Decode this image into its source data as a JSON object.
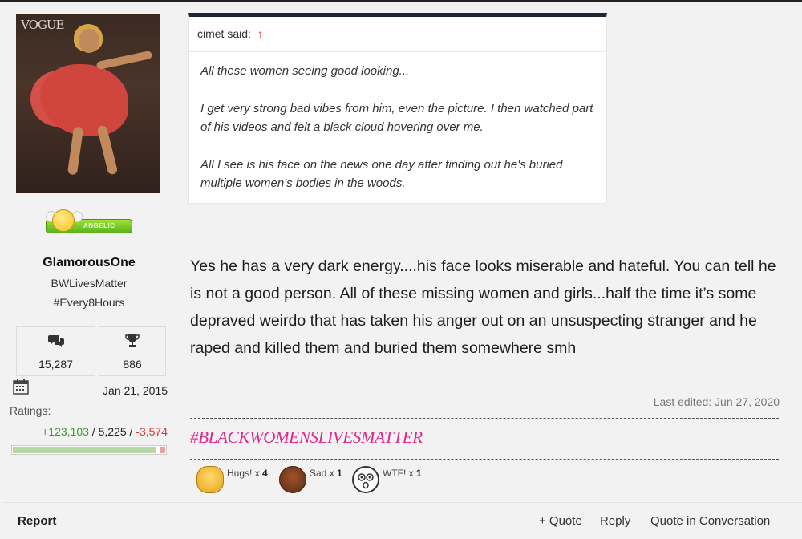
{
  "user": {
    "avatar_text": "VOGUE",
    "badge_text": "ANGELIC",
    "name": "GlamorousOne",
    "title_line1": "BWLivesMatter",
    "title_line2": "#Every8Hours",
    "messages_count": "15,287",
    "trophy_points": "886",
    "join_date": "Jan 21, 2015",
    "ratings_label": "Ratings:",
    "ratings_positive": "+123,103",
    "ratings_neutral": "5,225",
    "ratings_negative": "-3,574",
    "ratings_separator": "/",
    "rating_bar_positive_fraction": 0.94,
    "rating_bar_negative_fraction": 0.03
  },
  "quote": {
    "author": "cimet said:",
    "arrow": "↑",
    "lines": [
      "All these women seeing good looking...",
      "I get very strong bad vibes from him, even the picture. I then watched part of his videos and felt a black cloud hovering over me.",
      "All I see is his face on the news one day after finding out he's buried multiple women's bodies in the woods."
    ]
  },
  "post": {
    "body": "Yes he has a very dark energy....his face looks miserable and hateful. You can tell he is not a good person. All of these missing women and girls...half the time it’s some depraved weirdo that has taken his anger out on an unsuspecting stranger and he raped and killed them and buried them somewhere smh",
    "last_edited": "Last edited: Jun 27, 2020",
    "signature": "#BLACKWOMENSLIVESMATTER"
  },
  "reactions": [
    {
      "label": "Hugs!",
      "x": "x",
      "count": "4",
      "icon": "hugs-emoji"
    },
    {
      "label": "Sad",
      "x": "x",
      "count": "1",
      "icon": "sad-emoji"
    },
    {
      "label": "WTF!",
      "x": "x",
      "count": "1",
      "icon": "wtf-emoji"
    }
  ],
  "footer": {
    "report": "Report",
    "quote": "+ Quote",
    "reply": "Reply",
    "quote_conversation": "Quote in Conversation"
  },
  "colors": {
    "positive": "#3a9c2c",
    "negative": "#d43a3a",
    "signature": "#e0268a",
    "quote_border": "#1d2731"
  }
}
